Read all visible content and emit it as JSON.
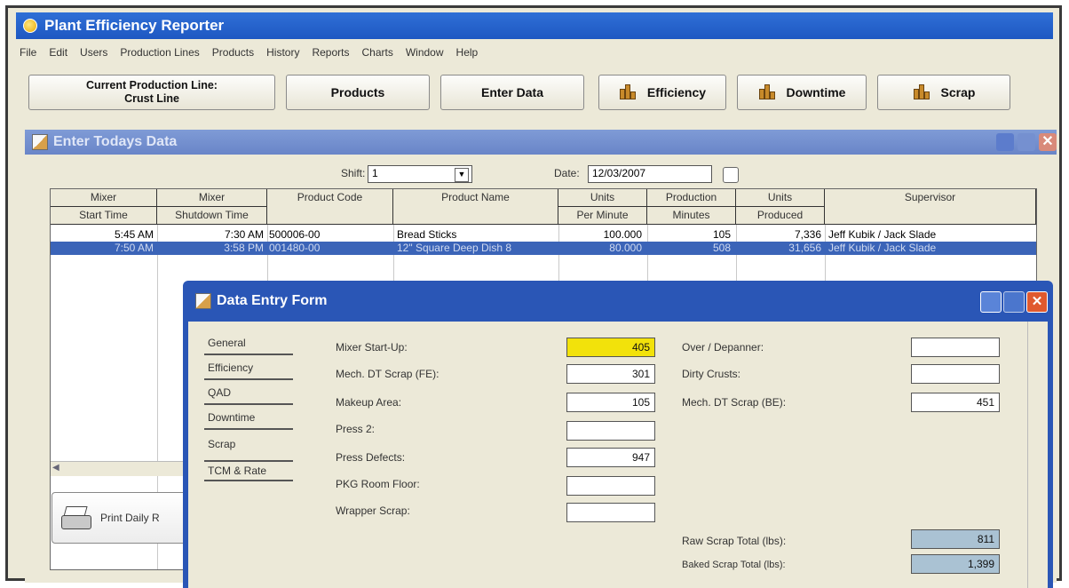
{
  "app": {
    "title": "Plant Efficiency Reporter",
    "menu": [
      "File",
      "Edit",
      "Users",
      "Production Lines",
      "Products",
      "History",
      "Reports",
      "Charts",
      "Window",
      "Help"
    ]
  },
  "toolbar": {
    "current_line_label": "Current Production Line:",
    "current_line_value": "Crust Line",
    "products": "Products",
    "enter_data": "Enter Data",
    "efficiency": "Efficiency",
    "downtime": "Downtime",
    "scrap": "Scrap"
  },
  "enter_window": {
    "title": "Enter Todays Data",
    "shift_label": "Shift:",
    "shift_value": "1",
    "date_label": "Date:",
    "date_value": "12/03/2007",
    "columns": [
      {
        "top": "Mixer",
        "bottom": "Start Time"
      },
      {
        "top": "Mixer",
        "bottom": "Shutdown Time"
      },
      {
        "top": "Product Code",
        "bottom": ""
      },
      {
        "top": "Product Name",
        "bottom": ""
      },
      {
        "top": "Units",
        "bottom": "Per Minute"
      },
      {
        "top": "Production",
        "bottom": "Minutes"
      },
      {
        "top": "Units",
        "bottom": "Produced"
      },
      {
        "top": "Supervisor",
        "bottom": ""
      }
    ],
    "rows": [
      {
        "start": "5:45 AM",
        "shutdown": "7:30 AM",
        "code": "500006-00",
        "name": "Bread Sticks",
        "upm": "100.000",
        "minutes": "105",
        "produced": "7,336",
        "supervisor": "Jeff Kubik / Jack Slade"
      },
      {
        "start": "7:50 AM",
        "shutdown": "3:58 PM",
        "code": "001480-00",
        "name": "12\" Square Deep Dish 8",
        "upm": "80.000",
        "minutes": "508",
        "produced": "31,656",
        "supervisor": "Jeff Kubik / Jack Slade"
      }
    ],
    "print_label": "Print Daily R"
  },
  "form": {
    "title": "Data Entry Form",
    "tabs": [
      "General",
      "Efficiency",
      "QAD",
      "Downtime",
      "Scrap",
      "TCM & Rate"
    ],
    "left_fields": [
      {
        "label": "Mixer Start-Up:",
        "value": "405",
        "highlight": true
      },
      {
        "label": "Mech. DT Scrap (FE):",
        "value": "301"
      },
      {
        "label": "Makeup Area:",
        "value": "105"
      },
      {
        "label": "Press 2:",
        "value": ""
      },
      {
        "label": "Press Defects:",
        "value": "947"
      },
      {
        "label": "PKG Room Floor:",
        "value": ""
      },
      {
        "label": "Wrapper Scrap:",
        "value": ""
      }
    ],
    "right_fields": [
      {
        "label": "Over / Depanner:",
        "value": ""
      },
      {
        "label": "Dirty Crusts:",
        "value": ""
      },
      {
        "label": "Mech. DT Scrap (BE):",
        "value": "451"
      }
    ],
    "totals": [
      {
        "label": "Raw Scrap Total (lbs):",
        "value": "811"
      },
      {
        "label": "Baked Scrap Total (lbs):",
        "value": "1,399"
      }
    ]
  },
  "colors": {
    "title_blue": "#1e58c2",
    "selection": "#3b64b8",
    "highlight": "#f2e20b",
    "total_field": "#aac2d3"
  }
}
